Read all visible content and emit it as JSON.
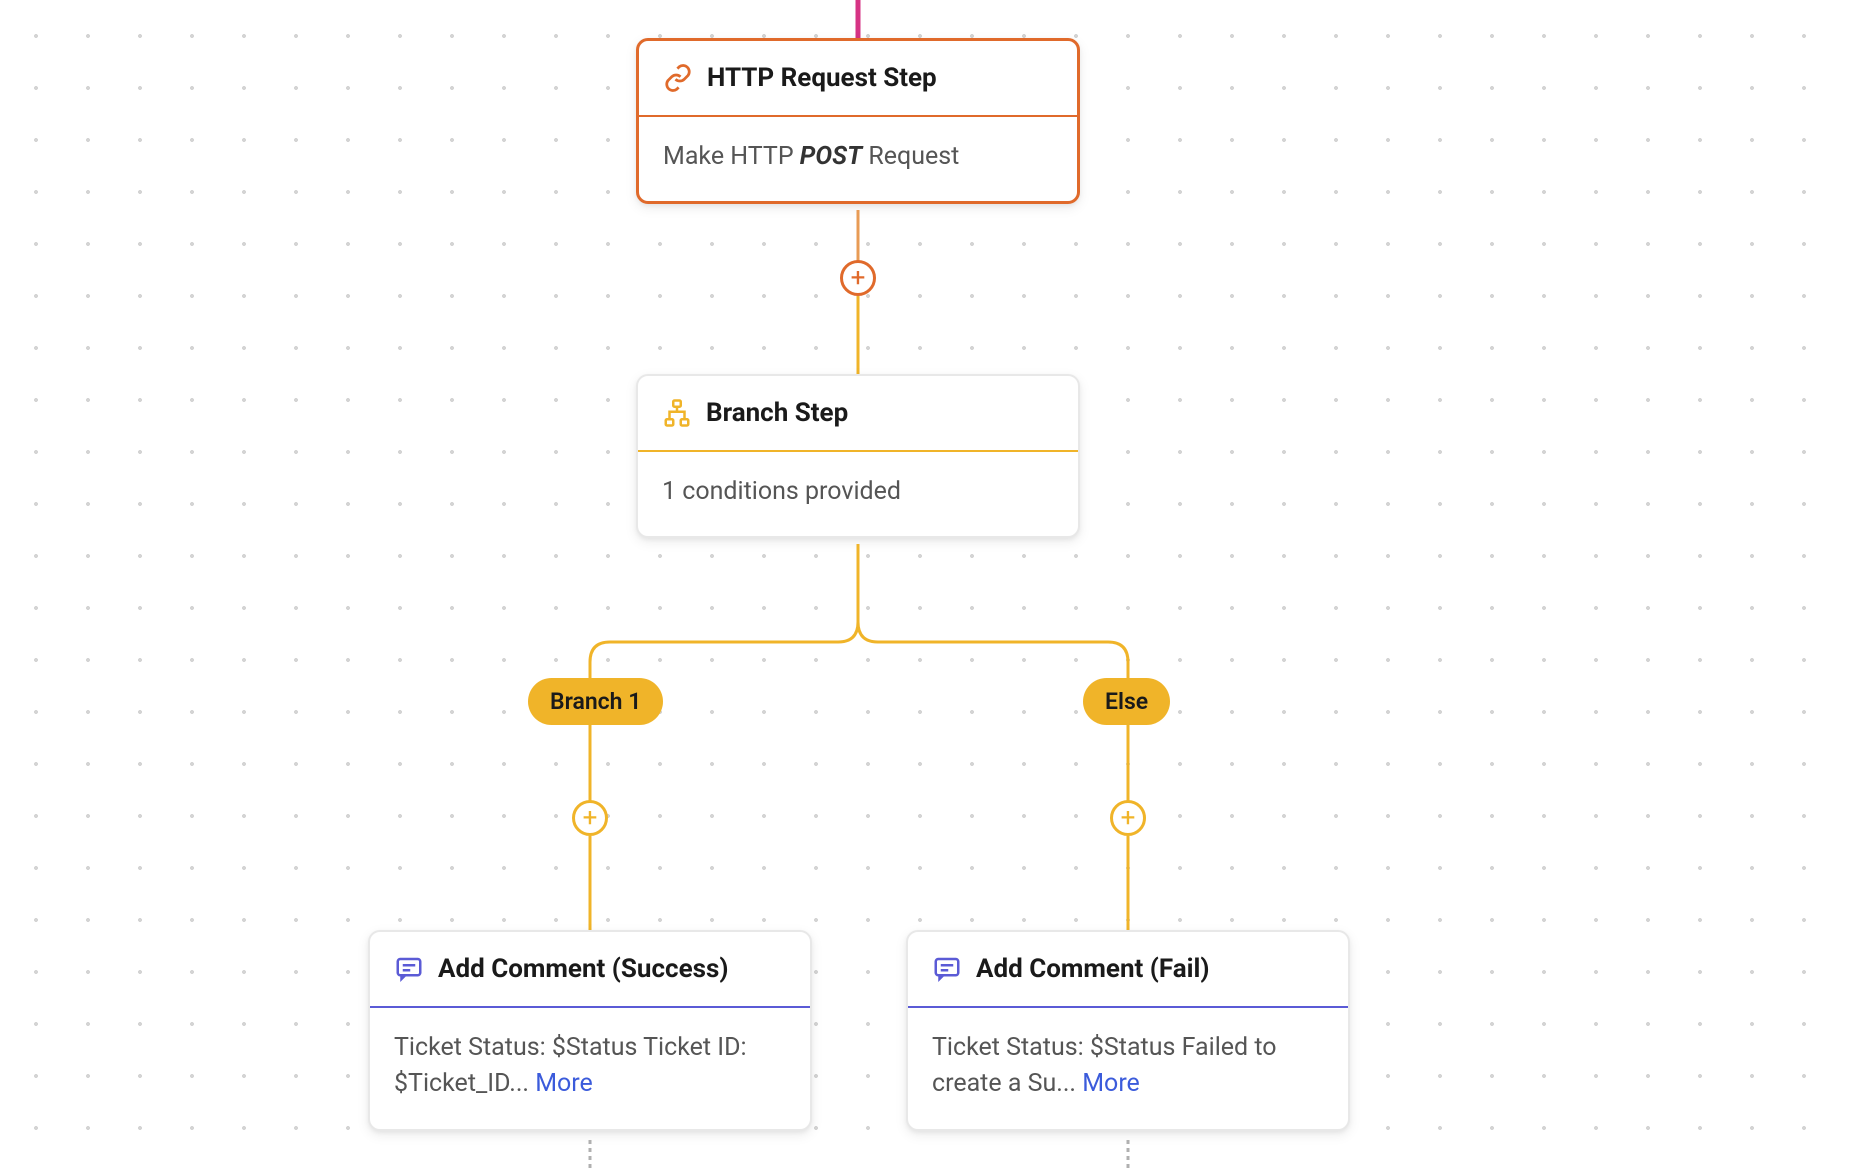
{
  "nodes": {
    "http": {
      "title": "HTTP Request Step",
      "body_prefix": "Make HTTP ",
      "body_method": "POST",
      "body_suffix": " Request"
    },
    "branch": {
      "title": "Branch Step",
      "body": "1 conditions provided"
    },
    "comment_success": {
      "title": "Add Comment (Success)",
      "body_text": "Ticket Status: $Status Ticket ID: $Ticket_ID... ",
      "more_label": "More"
    },
    "comment_fail": {
      "title": "Add Comment (Fail)",
      "body_text": "Ticket Status: $Status Failed to create a Su... ",
      "more_label": "More"
    }
  },
  "pills": {
    "branch1": "Branch 1",
    "else": "Else"
  },
  "icons": {
    "http": "link-icon",
    "branch": "sitemap-icon",
    "comment": "comment-icon"
  },
  "colors": {
    "http": "#e06a2b",
    "branch": "#f0b429",
    "comment": "#5b5bd6"
  }
}
